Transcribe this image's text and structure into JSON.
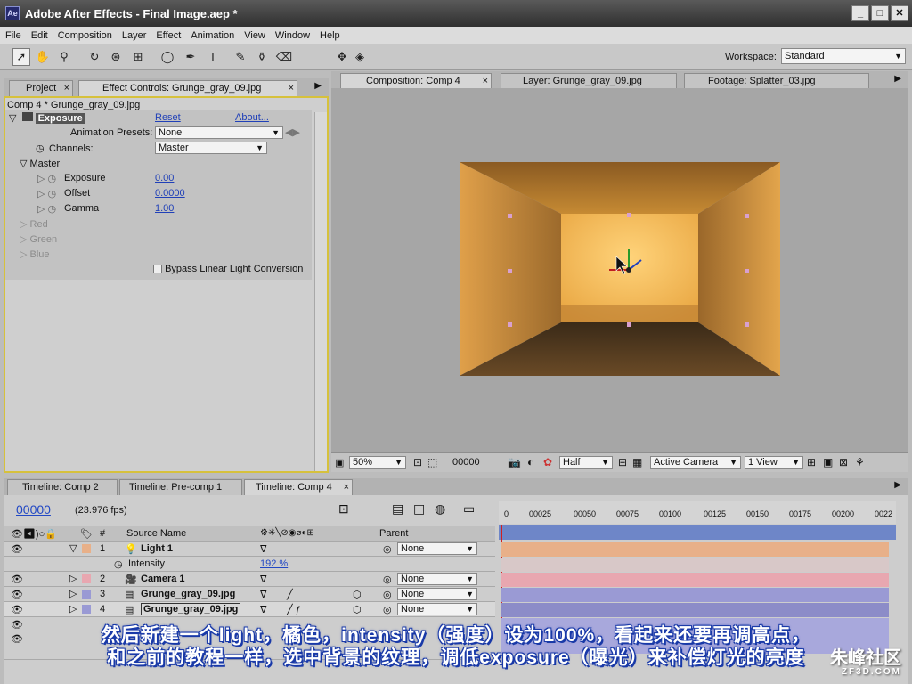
{
  "window": {
    "title": "Adobe After Effects - Final Image.aep *",
    "minimize": "_",
    "maximize": "□",
    "close": "✕",
    "app_icon_text": "Ae"
  },
  "menu": [
    "File",
    "Edit",
    "Composition",
    "Layer",
    "Effect",
    "Animation",
    "View",
    "Window",
    "Help"
  ],
  "toolbar": {
    "tools": [
      "selection-tool",
      "hand-tool",
      "zoom-tool",
      "rotate-tool",
      "orbit-camera-tool",
      "pan-behind-tool",
      "mask-tool",
      "pen-tool",
      "type-tool",
      "brush-tool",
      "clone-stamp-tool",
      "eraser-tool"
    ],
    "workspace_label": "Workspace:",
    "workspace_value": "Standard"
  },
  "project_panel": {
    "tabs": [
      "Project",
      "Effect Controls: Grunge_gray_09.jpg"
    ],
    "breadcrumb": "Comp 4 * Grunge_gray_09.jpg",
    "effect_name": "Exposure",
    "reset": "Reset",
    "about": "About...",
    "animation_presets_label": "Animation Presets:",
    "animation_presets_value": "None",
    "channels_label": "Channels:",
    "channels_value": "Master",
    "master_label": "Master",
    "exposure_label": "Exposure",
    "exposure_value": "0.00",
    "offset_label": "Offset",
    "offset_value": "0.0000",
    "gamma_label": "Gamma",
    "gamma_value": "1.00",
    "red_label": "Red",
    "green_label": "Green",
    "blue_label": "Blue",
    "bypass_label": "Bypass Linear Light Conversion"
  },
  "comp_panel": {
    "tabs": [
      "Composition: Comp 4",
      "Layer: Grunge_gray_09.jpg",
      "Footage: Splatter_03.jpg"
    ],
    "zoom": "50%",
    "timecode": "00000",
    "resolution": "Half",
    "camera": "Active Camera",
    "view": "1 View"
  },
  "timeline": {
    "tabs": [
      "Timeline: Comp 2",
      "Timeline: Pre-comp 1",
      "Timeline: Comp 4"
    ],
    "current_time": "00000",
    "fps": "(23.976 fps)",
    "col_number": "#",
    "col_source": "Source Name",
    "col_parent": "Parent",
    "ruler_ticks": [
      "0",
      "00025",
      "00050",
      "00075",
      "00100",
      "00125",
      "00150",
      "00175",
      "00200",
      "0022"
    ],
    "layers": [
      {
        "num": "1",
        "name": "Light 1",
        "parent": "None",
        "color": "#e8b089"
      },
      {
        "num": "",
        "name": "Intensity",
        "value": "192 %",
        "color": "#d8c8c8"
      },
      {
        "num": "2",
        "name": "Camera 1",
        "parent": "None",
        "color": "#e8a7b0"
      },
      {
        "num": "3",
        "name": "Grunge_gray_09.jpg",
        "parent": "None",
        "color": "#9a9ad4"
      },
      {
        "num": "4",
        "name": "Grunge_gray_09.jpg",
        "parent": "None",
        "color": "#9a9ad4"
      }
    ]
  },
  "subtitles": {
    "line1": "然后新建一个light，橘色，intensity（强度）设为100%，看起来还要再调高点，",
    "line2": "和之前的教程一样，选中背景的纹理，调低exposure（曝光）来补偿灯光的亮度"
  },
  "watermark": {
    "main": "朱峰社区",
    "sub": "ZF3D.COM"
  },
  "colors": {
    "accent_border": "#d6c13c",
    "subtitle_outline": "#1a3aa8",
    "light_orange": "#f0b040"
  }
}
